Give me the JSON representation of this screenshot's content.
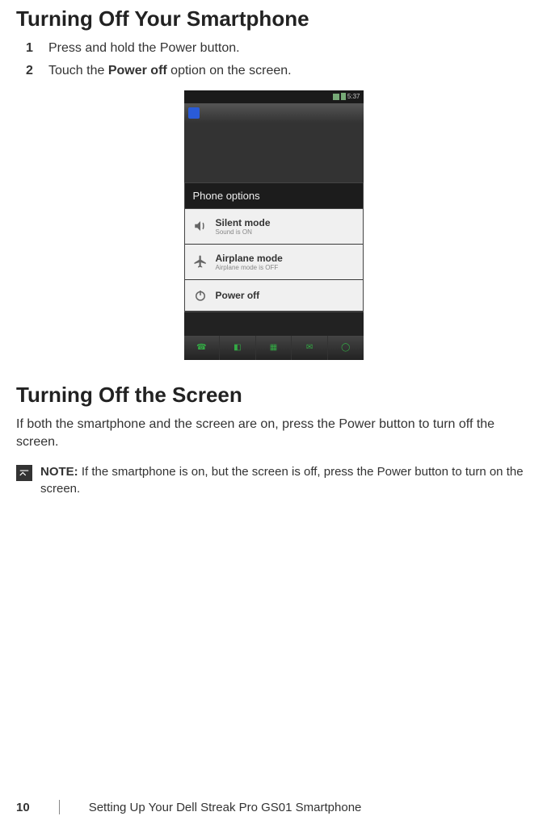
{
  "heading1": "Turning Off Your Smartphone",
  "steps": [
    {
      "num": "1",
      "pre": "Press and hold the Power button."
    },
    {
      "num": "2",
      "pre": "Touch the ",
      "bold": "Power off",
      "post": " option on the screen."
    }
  ],
  "phone": {
    "status_time": "5:37",
    "dialog_title": "Phone options",
    "items": [
      {
        "title": "Silent mode",
        "sub": "Sound is ON"
      },
      {
        "title": "Airplane mode",
        "sub": "Airplane mode is OFF"
      },
      {
        "title": "Power off",
        "sub": ""
      }
    ]
  },
  "heading2": "Turning Off the Screen",
  "body2": "If both the smartphone and the screen are on, press the Power button to turn off the screen.",
  "note_label": "NOTE:",
  "note_body": " If the smartphone is on, but the screen is off, press the Power button to turn on the screen.",
  "footer": {
    "page": "10",
    "chapter": "Setting Up Your Dell Streak Pro GS01 Smartphone"
  }
}
